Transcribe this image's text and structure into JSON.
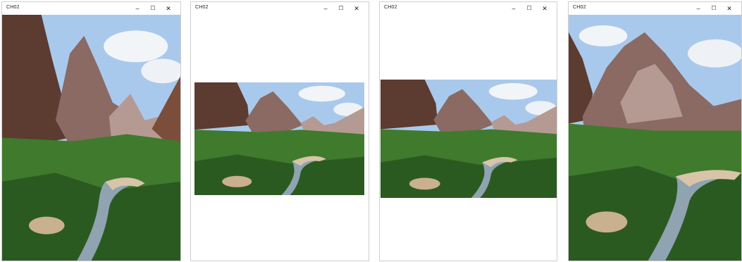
{
  "windows": [
    {
      "title": "CH02",
      "minimize_glyph": "–",
      "maximize_glyph": "☐",
      "close_glyph": "✕",
      "image_desc": "scene-cropped-tall"
    },
    {
      "title": "CH02",
      "minimize_glyph": "–",
      "maximize_glyph": "☐",
      "close_glyph": "✕",
      "image_desc": "scene-letterbox"
    },
    {
      "title": "CH02",
      "minimize_glyph": "–",
      "maximize_glyph": "☐",
      "close_glyph": "✕",
      "image_desc": "scene-letterbox"
    },
    {
      "title": "CH02",
      "minimize_glyph": "–",
      "maximize_glyph": "☐",
      "close_glyph": "✕",
      "image_desc": "scene-cropped-tall"
    }
  ],
  "colors": {
    "sky": "#a9c9ec",
    "cloud": "#f2f5f8",
    "rock_dark": "#5c3b30",
    "rock_mid": "#8a6a62",
    "rock_light": "#b59a93",
    "forest": "#3f7a2d",
    "forest_dark": "#2a5a20",
    "river": "#8fa3b1",
    "sand": "#d8c4a8"
  }
}
